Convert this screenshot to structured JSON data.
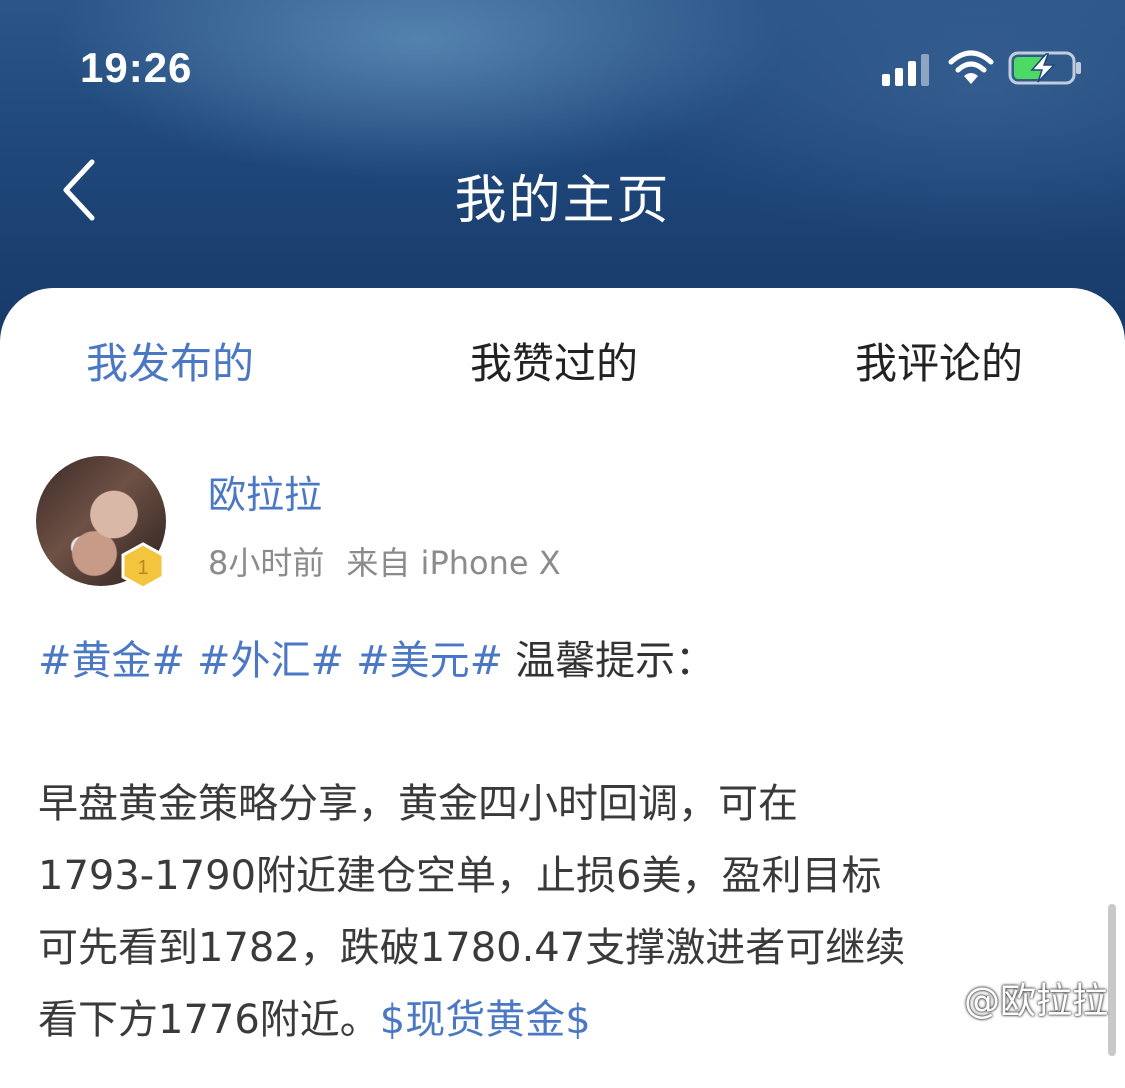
{
  "status_bar": {
    "time": "19:26"
  },
  "header": {
    "title": "我的主页"
  },
  "tabs": [
    {
      "label": "我发布的",
      "active": true
    },
    {
      "label": "我赞过的",
      "active": false
    },
    {
      "label": "我评论的",
      "active": false
    }
  ],
  "post": {
    "author": "欧拉拉",
    "level": "1",
    "time": "8小时前",
    "source": "来自 iPhone X",
    "tags": [
      "#黄金#",
      "#外汇#",
      "#美元#"
    ],
    "intro": "温馨提示：",
    "lines": [
      "早盘黄金策略分享，黄金四小时回调，可在",
      "1793-1790附近建仓空单，止损6美，盈利目标",
      "可先看到1782，跌破1780.47支撑激进者可继续",
      "看下方1776附近。"
    ],
    "stock_link": "$现货黄金$"
  },
  "watermark": "@欧拉拉",
  "colors": {
    "accent": "#4b78c4",
    "header_bg": "#1f477a"
  }
}
